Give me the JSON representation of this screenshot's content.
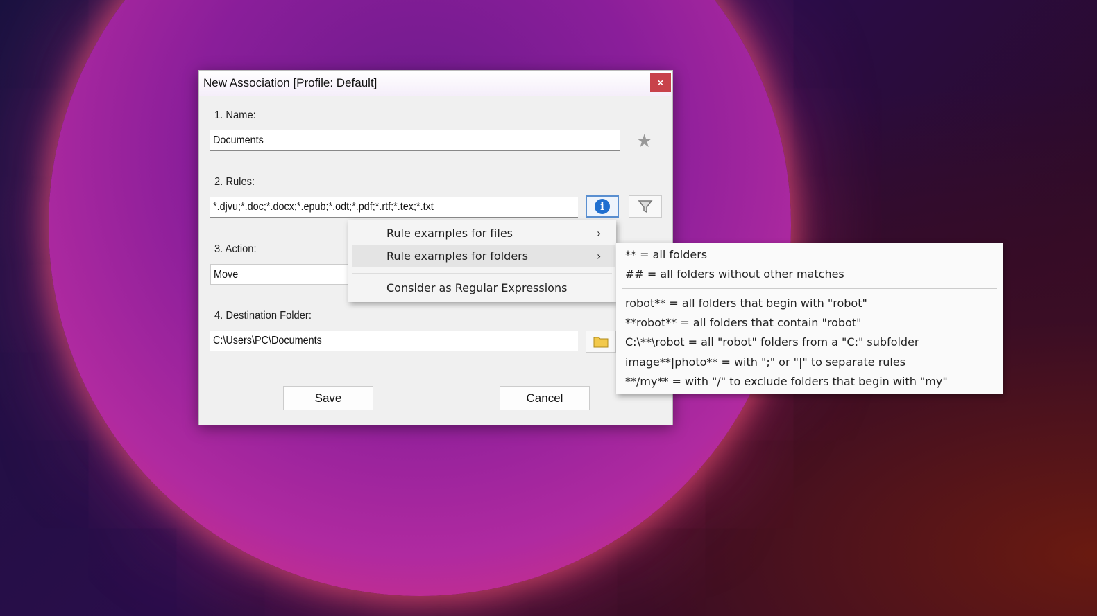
{
  "dialog": {
    "title": "New Association [Profile: Default]",
    "close_label": "×",
    "name_label": "1. Name:",
    "name_value": "Documents",
    "rules_label": "2. Rules:",
    "rules_value": "*.djvu;*.doc;*.docx;*.epub;*.odt;*.pdf;*.rtf;*.tex;*.txt",
    "action_label": "3. Action:",
    "action_value": "Move",
    "dest_label": "4. Destination Folder:",
    "dest_value": "C:\\Users\\PC\\Documents",
    "save_label": "Save",
    "cancel_label": "Cancel"
  },
  "menu": {
    "items": [
      "Rule examples for files",
      "Rule examples for folders",
      "Consider as Regular Expressions"
    ],
    "arrow": "›"
  },
  "submenu": {
    "items": [
      "** = all folders",
      "## = all folders without other matches",
      "robot** = all folders that begin with \"robot\"",
      "**robot** = all folders that contain \"robot\"",
      "C:\\**\\robot = all \"robot\" folders from a \"C:\" subfolder",
      "image**|photo** = with \";\" or \"|\" to separate rules",
      "**/my** = with \"/\" to exclude folders that begin with \"my\""
    ]
  }
}
